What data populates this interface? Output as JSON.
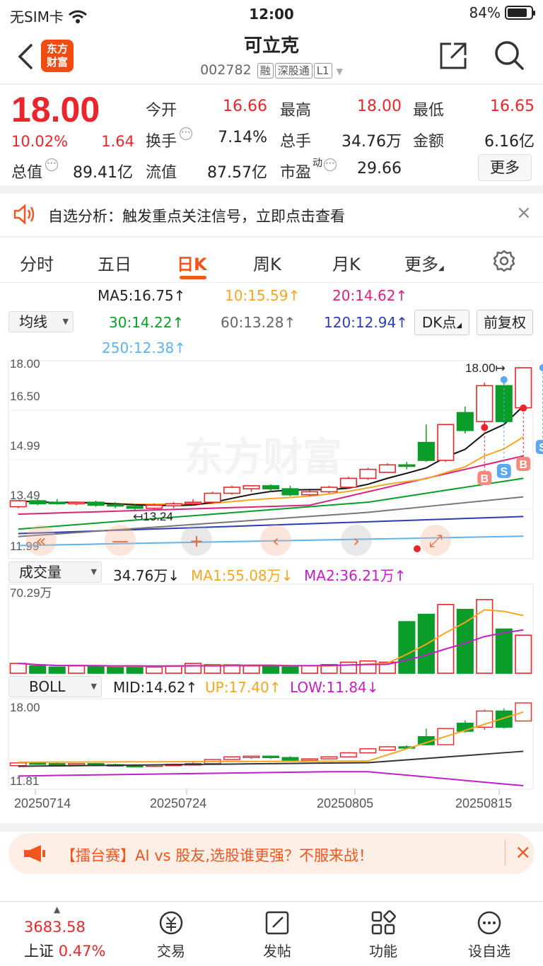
{
  "status": {
    "carrier": "无SIM卡",
    "time": "12:00",
    "battery": "84%",
    "battery_level": 0.84
  },
  "header": {
    "title": "可立克",
    "code": "002782",
    "tags": [
      "融",
      "深股通",
      "L1"
    ],
    "logo_text": [
      "东方",
      "财富"
    ]
  },
  "quote": {
    "price": "18.00",
    "change_pct": "10.02%",
    "change": "1.64",
    "fields": [
      {
        "label": "今开",
        "value": "16.66",
        "color": "red"
      },
      {
        "label": "最高",
        "value": "18.00",
        "color": "red"
      },
      {
        "label": "最低",
        "value": "16.65",
        "color": "red"
      },
      {
        "label": "换手",
        "value": "7.14%",
        "color": "dark"
      },
      {
        "label": "总手",
        "value": "34.76万",
        "color": "dark"
      },
      {
        "label": "金额",
        "value": "6.16亿",
        "color": "dark"
      },
      {
        "label": "总值",
        "value": "89.41亿",
        "color": "dark"
      },
      {
        "label": "流值",
        "value": "87.57亿",
        "color": "dark"
      },
      {
        "label": "市盈",
        "value": "29.66",
        "color": "dark",
        "sup": "动"
      }
    ],
    "more_button": "更多"
  },
  "notice": {
    "text": "自选分析：触发重点关注信号，立即点击查看"
  },
  "tabs": [
    "分时",
    "五日",
    "日K",
    "周K",
    "月K",
    "更多"
  ],
  "active_tab": 2,
  "indicators": {
    "ma_selector": "均线",
    "ma_values": [
      "MA5:16.75↑",
      "10:15.59↑",
      "20:14.62↑",
      "30:14.22↑",
      "60:13.28↑",
      "120:12.94↑",
      "250:12.38↑"
    ],
    "dk_button": "DK点",
    "adjust_button": "前复权",
    "price_axis": [
      "18.00",
      "16.50",
      "14.99",
      "13.49",
      "11.99"
    ],
    "high_marker": "18.00",
    "low_marker": "13.24",
    "watermark": "东方财富",
    "vol_selector": "成交量",
    "vol_values": [
      "34.76万↓",
      "MA1:55.08万↓",
      "MA2:36.21万↑"
    ],
    "vol_axis": "70.29万",
    "boll_selector": "BOLL",
    "boll_values": [
      "MID:14.62↑",
      "UP:17.40↑",
      "LOW:11.84↓"
    ],
    "boll_axis": [
      "18.00",
      "11.81"
    ],
    "dates": [
      "20250714",
      "20250724",
      "20250805",
      "20250815"
    ],
    "signals": [
      "B",
      "S",
      "B",
      "S"
    ]
  },
  "chart_data": {
    "type": "candlestick",
    "candles": [
      {
        "o": 13.35,
        "h": 13.55,
        "c": 13.55,
        "l": 13.3
      },
      {
        "o": 13.55,
        "h": 13.6,
        "c": 13.45,
        "l": 13.4
      },
      {
        "o": 13.5,
        "h": 13.6,
        "c": 13.48,
        "l": 13.42
      },
      {
        "o": 13.45,
        "h": 13.52,
        "c": 13.5,
        "l": 13.4
      },
      {
        "o": 13.5,
        "h": 13.55,
        "c": 13.4,
        "l": 13.35
      },
      {
        "o": 13.42,
        "h": 13.5,
        "c": 13.38,
        "l": 13.3
      },
      {
        "o": 13.36,
        "h": 13.45,
        "c": 13.3,
        "l": 13.24
      },
      {
        "o": 13.3,
        "h": 13.45,
        "c": 13.4,
        "l": 13.26
      },
      {
        "o": 13.38,
        "h": 13.5,
        "c": 13.45,
        "l": 13.3
      },
      {
        "o": 13.45,
        "h": 13.6,
        "c": 13.5,
        "l": 13.4
      },
      {
        "o": 13.5,
        "h": 13.85,
        "c": 13.8,
        "l": 13.45
      },
      {
        "o": 13.8,
        "h": 14.05,
        "c": 14.0,
        "l": 13.75
      },
      {
        "o": 13.95,
        "h": 14.05,
        "c": 14.05,
        "l": 13.85
      },
      {
        "o": 14.05,
        "h": 14.1,
        "c": 13.95,
        "l": 13.85
      },
      {
        "o": 13.95,
        "h": 14.05,
        "c": 13.75,
        "l": 13.7
      },
      {
        "o": 13.75,
        "h": 13.9,
        "c": 13.85,
        "l": 13.7
      },
      {
        "o": 13.85,
        "h": 14.05,
        "c": 14.0,
        "l": 13.8
      },
      {
        "o": 14.0,
        "h": 14.35,
        "c": 14.3,
        "l": 13.95
      },
      {
        "o": 14.3,
        "h": 14.65,
        "c": 14.6,
        "l": 14.25
      },
      {
        "o": 14.5,
        "h": 14.8,
        "c": 14.75,
        "l": 14.5
      },
      {
        "o": 14.75,
        "h": 14.85,
        "c": 14.7,
        "l": 14.6
      },
      {
        "o": 15.5,
        "h": 16.1,
        "c": 14.9,
        "l": 14.85
      },
      {
        "o": 14.9,
        "h": 16.1,
        "c": 16.1,
        "l": 14.85
      },
      {
        "o": 16.5,
        "h": 16.7,
        "c": 15.9,
        "l": 15.8
      },
      {
        "o": 16.2,
        "h": 17.5,
        "c": 17.4,
        "l": 16.0
      },
      {
        "o": 17.4,
        "h": 17.6,
        "c": 16.2,
        "l": 16.1
      },
      {
        "o": 16.66,
        "h": 18.0,
        "c": 18.0,
        "l": 16.65
      }
    ],
    "volumes": [
      8,
      6,
      5,
      6,
      6,
      5,
      6,
      5,
      6,
      8,
      7,
      7,
      6,
      6,
      5,
      6,
      7,
      9,
      10,
      9,
      42,
      48,
      56,
      52,
      60,
      36,
      31
    ],
    "ylim": [
      11.99,
      18.0
    ],
    "vol_max": 70.29
  }
}
